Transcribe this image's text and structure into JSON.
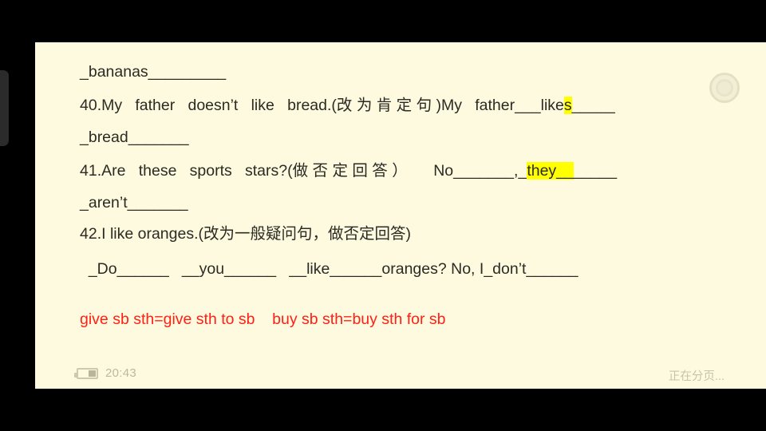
{
  "reader": {
    "background_color": "#fdfadf",
    "text_color": "#2b2b23",
    "highlight_color": "#ffff00",
    "note_color": "#ff2016",
    "drawer_handle": "drawer-handle",
    "target_icon": "bullseye-icon"
  },
  "content": {
    "line_1": "_bananas_________",
    "line_2_q": "40.My   father   doesn’t   like   bread.(改 为 肯 定 句 )My   father___like",
    "line_2_hl": "s",
    "line_2_tail": "_____",
    "line_3_cont": "_bread_______",
    "line_4_q": "41.Are   these   sports   stars?(做 否 定 回 答 ）      No_______,_",
    "line_4_hl": "they__",
    "line_4_tail": "_____",
    "line_5_cont": "_aren’t_______",
    "line_6_q": "42.I like oranges.(改为一般疑问句，做否定回答)",
    "line_7_ans": "  _Do______   __you______   __like______oranges? No, I_don’t______",
    "note_line": "give sb sth=give sth to sb    buy sb sth=buy sth for sb"
  },
  "statusbar": {
    "battery_icon": "battery-icon",
    "clock": "20:43",
    "status_message": "正在分页..."
  }
}
